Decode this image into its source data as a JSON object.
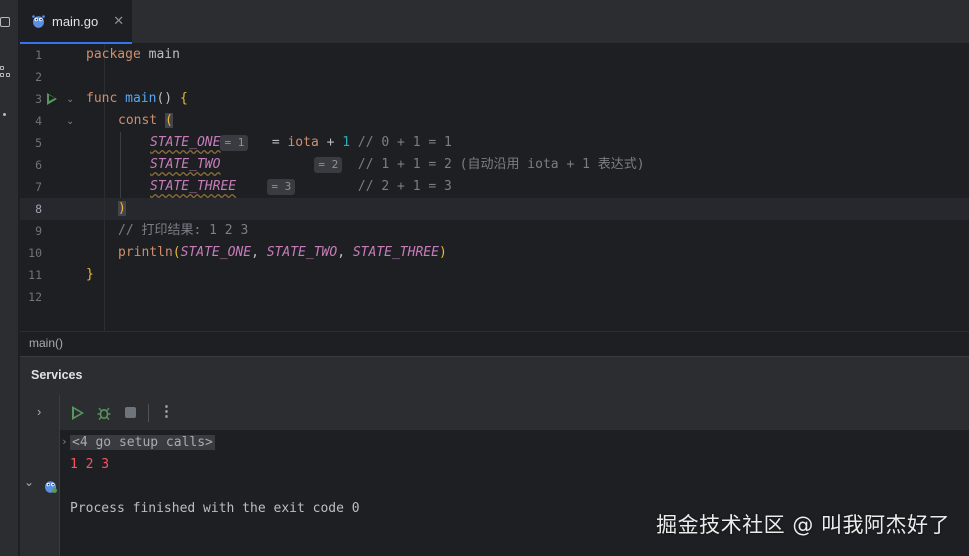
{
  "editor": {
    "tab": {
      "label": "main.go",
      "close": "✕"
    },
    "line_numbers": [
      "1",
      "2",
      "3",
      "4",
      "5",
      "6",
      "7",
      "8",
      "9",
      "10",
      "11",
      "12"
    ],
    "current_line": "8",
    "code": {
      "l1_kw": "package",
      "l1_id": "main",
      "l3_kw": "func",
      "l3_fn": "main",
      "l3_rest": "()",
      "l3_brace": "{",
      "l4_kw": "const",
      "l4_paren": "(",
      "l5_name": "STATE_ONE",
      "l5_hint": "= 1",
      "l5_eq": " = ",
      "l5_iota": "iota",
      "l5_plus": " + ",
      "l5_num": "1",
      "l5_comment": "// 0 + 1 = 1",
      "l6_name": "STATE_TWO",
      "l6_hint": "= 2",
      "l6_comment": "// 1 + 1 = 2 (自动沿用 iota + 1 表达式)",
      "l7_name": "STATE_THREE",
      "l7_hint": "= 3",
      "l7_comment": "// 2 + 1 = 3",
      "l8_paren": ")",
      "l9_comment": "// 打印结果: 1 2 3",
      "l10_fn": "println",
      "l10_open": "(",
      "l10_a": "STATE_ONE",
      "l10_sep1": ", ",
      "l10_b": "STATE_TWO",
      "l10_sep2": ", ",
      "l10_c": "STATE_THREE",
      "l10_close": ")",
      "l11_brace": "}"
    }
  },
  "breadcrumb": {
    "item": "main()"
  },
  "services": {
    "title": "Services",
    "console": {
      "setup_calls": "<4 go setup calls>",
      "output": "1 2 3",
      "process": "Process finished with the exit code 0"
    }
  },
  "watermark": "掘金技术社区 @ 叫我阿杰好了",
  "colors": {
    "accent": "#3574f0",
    "run": "#57965c",
    "error_output": "#f75464",
    "constant": "#c77dbb",
    "keyword": "#cf8e6d"
  }
}
